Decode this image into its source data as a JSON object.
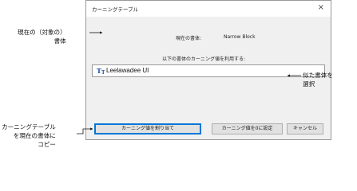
{
  "dialog": {
    "title": "カーニングテーブル",
    "close_glyph": "×",
    "current_font_label": "現在の書体",
    "current_font_colon": ":",
    "current_font_value": "Narrow Block",
    "instruction": "以下の書体のカーニング値を利用する:",
    "font_list": {
      "icon": "truetype-font-icon",
      "selected_font": "Leelawadee UI"
    },
    "buttons": {
      "assign": "カーニング値を割り当て",
      "reset": "カーニング値を0に設定",
      "cancel": "キャンセル"
    }
  },
  "callouts": {
    "current_font_line1": "現在の（対象の）",
    "current_font_line2": "書体",
    "select_font_line1": "似た書体を",
    "select_font_line2": "選択",
    "copy_line1": "カーニングテーブル",
    "copy_line2": "を現在の書体に",
    "copy_line3": "コピー"
  }
}
